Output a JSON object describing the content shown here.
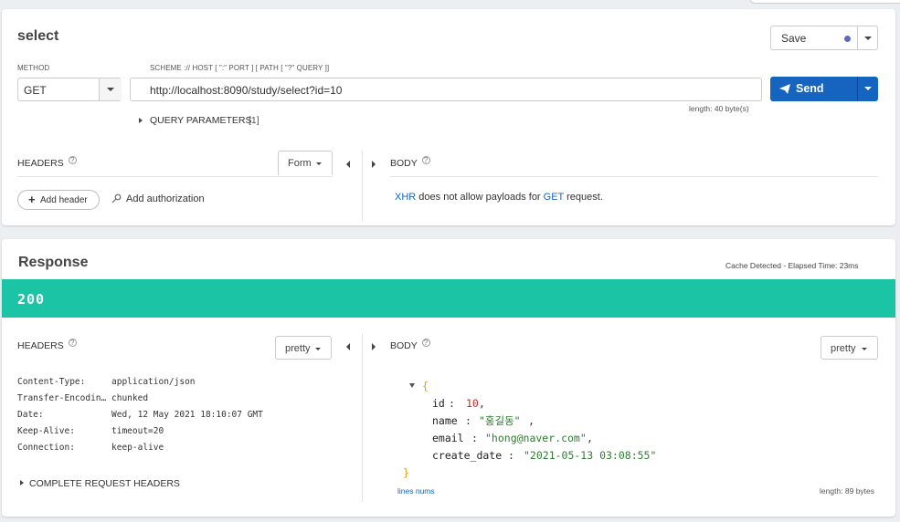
{
  "request": {
    "title": "select",
    "save_label": "Save",
    "method_label": "METHOD",
    "method_value": "GET",
    "url_label": "SCHEME :// HOST [ \":\" PORT ] [ PATH [ \"?\" QUERY ]]",
    "url_value": "http://localhost:8090/study/select?id=10",
    "send_label": "Send",
    "length_text": "length: 40 byte(s)",
    "query_params_label": "QUERY PARAMETERS",
    "query_params_count": "[1]",
    "headers_label": "HEADERS",
    "form_label": "Form",
    "body_label": "BODY",
    "add_header_label": "Add header",
    "add_authorization_label": "Add authorization",
    "body_message": {
      "xhr": "XHR",
      "middle": " does not allow payloads for ",
      "get": "GET",
      "end": " request."
    }
  },
  "response": {
    "title": "Response",
    "cache_text": "Cache Detected - Elapsed Time: 23ms",
    "status_code": "200",
    "status_color": "#1cc4a6",
    "headers_label": "HEADERS",
    "headers_view": "pretty",
    "body_label": "BODY",
    "body_view": "pretty",
    "headers": [
      {
        "key": "Content-Type:",
        "value": "application/json"
      },
      {
        "key": "Transfer-Encodin…",
        "value": "chunked"
      },
      {
        "key": "Date:",
        "value": "Wed, 12 May 2021 18:10:07 GMT"
      },
      {
        "key": "Keep-Alive:",
        "value": "timeout=20"
      },
      {
        "key": "Connection:",
        "value": "keep-alive"
      }
    ],
    "complete_request_headers_label": "COMPLETE REQUEST HEADERS",
    "json": {
      "open_brace": "{",
      "close_brace": "}",
      "id_key": "id",
      "id_value": "10",
      "name_key": "name",
      "name_value": "\"홍길동\"",
      "email_key": "email",
      "email_value": "\"hong@naver.com\"",
      "create_date_key": "create_date",
      "create_date_value": "\"2021-05-13 03:08:55\""
    },
    "lines_nums_label": "lines nums",
    "length_text": "length: 89 bytes"
  },
  "colors": {
    "accent": "#1565c0",
    "status": "#1cc4a6",
    "save_dot": "#5c6bc0"
  },
  "icons": [
    "help-icon",
    "paper-plane-icon",
    "plus-icon",
    "key-icon",
    "chevron-down-icon",
    "chevron-left-icon",
    "chevron-right-icon",
    "triangle-right-icon"
  ]
}
